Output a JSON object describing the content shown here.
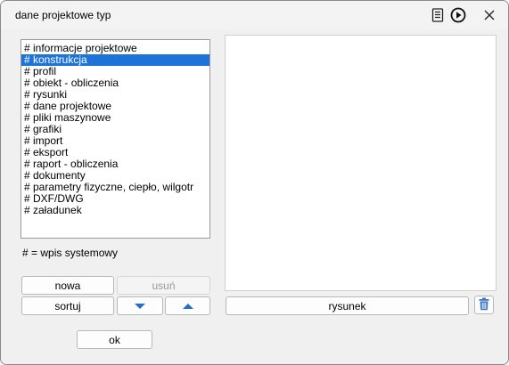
{
  "window": {
    "title": "dane projektowe typ"
  },
  "titlebar_icons": [
    "document-list-icon",
    "play-circle-icon",
    "close-icon"
  ],
  "list": {
    "items": [
      "# informacje projektowe",
      "# konstrukcja",
      "# profil",
      "# obiekt - obliczenia",
      "# rysunki",
      "# dane projektowe",
      "# pliki maszynowe",
      "# grafiki",
      "# import",
      "# eksport",
      "# raport - obliczenia",
      "# dokumenty",
      "# parametry fizyczne, ciepło, wilgotr",
      "# DXF/DWG",
      "# załadunek"
    ],
    "selected_index": 1
  },
  "legend": "# = wpis systemowy",
  "buttons": {
    "nowa": "nowa",
    "usun": "usuń",
    "sortuj": "sortuj",
    "rysunek": "rysunek",
    "ok": "ok"
  },
  "colors": {
    "selection": "#1e73d8",
    "arrow_blue": "#1f6fd1",
    "trash_blue": "#3a78c2"
  }
}
